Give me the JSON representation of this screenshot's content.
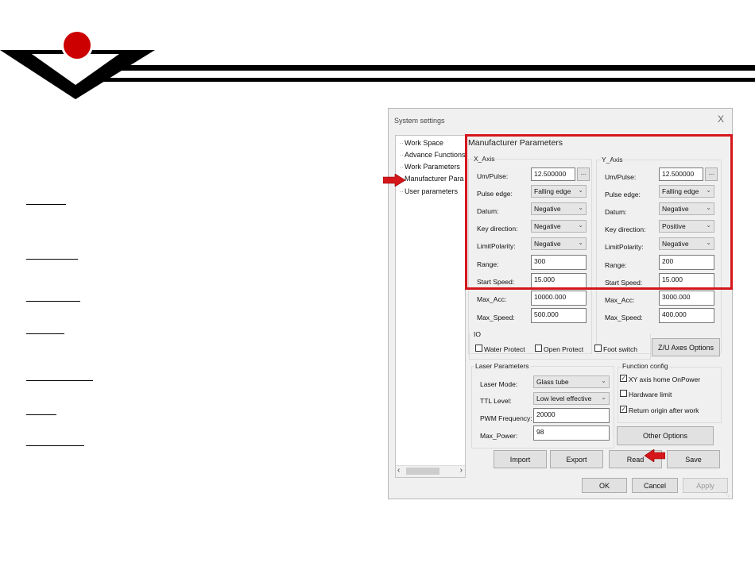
{
  "dialog": {
    "title": "System settings",
    "close": "X"
  },
  "tree": {
    "items": [
      "Work Space",
      "Advance Functions",
      "Work Parameters",
      "Manufacturer Para",
      "User parameters"
    ]
  },
  "manufacturer": {
    "title": "Manufacturer Parameters",
    "x_axis": {
      "title": "X_Axis",
      "um_pulse_label": "Um/Pulse:",
      "um_pulse": "12.500000",
      "dots": "...",
      "pulse_edge_label": "Pulse edge:",
      "pulse_edge": "Falling edge",
      "datum_label": "Datum:",
      "datum": "Negative",
      "key_direction_label": "Key direction:",
      "key_direction": "Negative",
      "limit_polarity_label": "LimitPolarity:",
      "limit_polarity": "Negative",
      "range_label": "Range:",
      "range": "300",
      "start_speed_label": "Start Speed:",
      "start_speed": "15.000",
      "max_acc_label": "Max_Acc:",
      "max_acc": "10000.000",
      "max_speed_label": "Max_Speed:",
      "max_speed": "500.000"
    },
    "y_axis": {
      "title": "Y_Axis",
      "um_pulse_label": "Um/Pulse:",
      "um_pulse": "12.500000",
      "dots": "...",
      "pulse_edge_label": "Pulse edge:",
      "pulse_edge": "Falling edge",
      "datum_label": "Datum:",
      "datum": "Negative",
      "key_direction_label": "Key direction:",
      "key_direction": "Positive",
      "limit_polarity_label": "LimitPolarity:",
      "limit_polarity": "Negative",
      "range_label": "Range:",
      "range": "200",
      "start_speed_label": "Start Speed:",
      "start_speed": "15.000",
      "max_acc_label": "Max_Acc:",
      "max_acc": "3000.000",
      "max_speed_label": "Max_Speed:",
      "max_speed": "400.000"
    }
  },
  "io": {
    "title": "IO",
    "water_protect": "Water Protect",
    "open_protect": "Open Protect",
    "foot_switch": "Foot switch",
    "zu_axes_button": "Z/U Axes Options"
  },
  "laser": {
    "title": "Laser Parameters",
    "laser_mode_label": "Laser Mode:",
    "laser_mode": "Glass tube",
    "ttl_level_label": "TTL Level:",
    "ttl_level": "Low level effective",
    "pwm_label": "PWM Frequency:",
    "pwm": "20000",
    "max_power_label": "Max_Power:",
    "max_power": "98"
  },
  "function_config": {
    "title": "Function config",
    "xy_home": "XY axis home OnPower",
    "xy_home_checked": true,
    "hardware_limit": "Hardware limit",
    "hardware_limit_checked": false,
    "return_origin": "Return origin after work",
    "return_origin_checked": true,
    "other_options_button": "Other Options"
  },
  "actions": {
    "import": "Import",
    "export": "Export",
    "read": "Read",
    "save": "Save"
  },
  "footer": {
    "ok": "OK",
    "cancel": "Cancel",
    "apply": "Apply"
  },
  "colors": {
    "accent_red": "#d5161b",
    "logo_red": "#cc0000"
  }
}
